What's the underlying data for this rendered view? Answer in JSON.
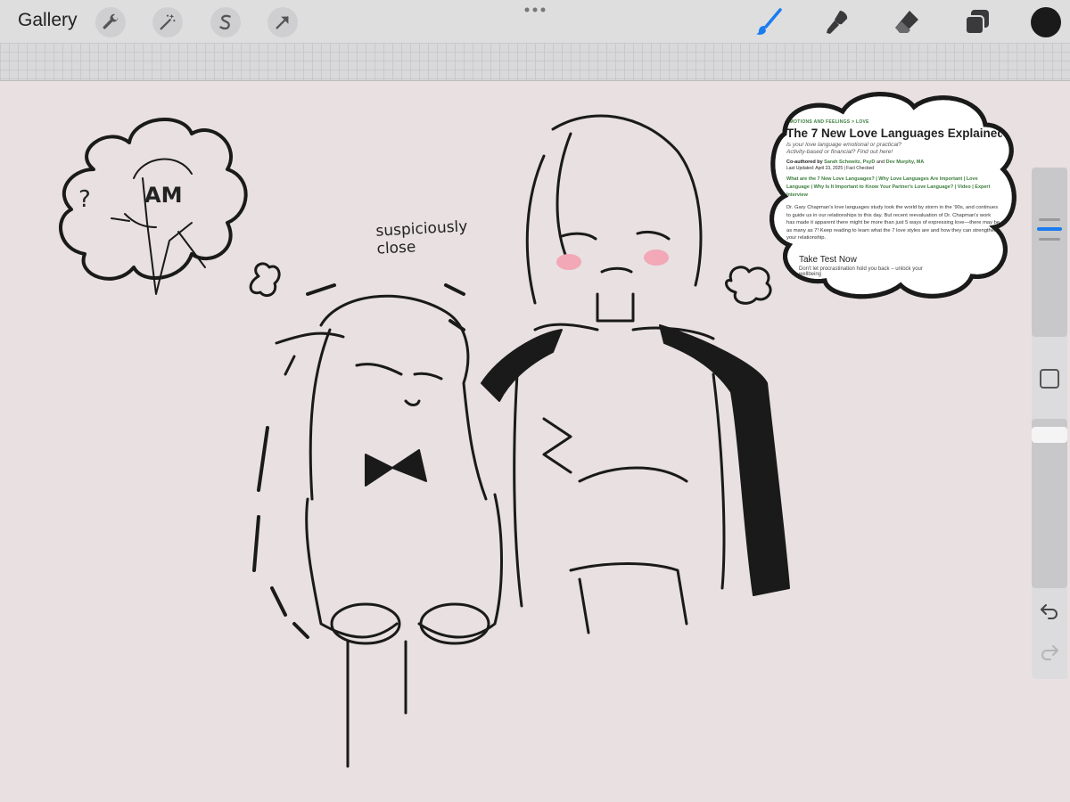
{
  "toolbar": {
    "gallery_label": "Gallery",
    "left_tools": [
      "wrench-icon",
      "magic-wand-icon",
      "selection-icon",
      "transform-arrow-icon"
    ],
    "right_tools": [
      "brush-icon",
      "smudge-icon",
      "eraser-icon",
      "layers-icon",
      "color-swatch"
    ],
    "active_tool": "brush",
    "accent_color": "#1a7cf0",
    "current_color": "#1a1a1a"
  },
  "canvas": {
    "background_color": "#e8e0e1",
    "annotation": "suspiciously\nclose",
    "thought_left": "AM",
    "question_mark": "?"
  },
  "article": {
    "breadcrumb": "EMOTIONS AND FEELINGS  >  LOVE",
    "title": "The 7 New Love Languages Explained",
    "subtitle": "Is your love language emotional or practical? Activity-based or financial? Find out here!",
    "authors_prefix": "Co-authored by",
    "author_1": "Sarah Schewitz, PsyD",
    "authors_and": "and",
    "author_2": "Dev Murphy, MA",
    "last_updated": "Last Updated: April 23, 2025   |  Fact Checked",
    "toc": "What are the 7 New Love Languages?  |  Why Love Languages Are Important  |  Love Language  |  Why Is It Important to Know Your Partner's Love Language?  |  Video  |  Expert Interview",
    "body": "Dr. Gary Chapman's love languages study took the world by storm in the '90s, and continues to guide us in our relationships to this day. But recent reevaluation of Dr. Chapman's work has made it apparent there might be more than just 5 ways of expressing love—there may be as many as 7! Keep reading to learn what the 7 love styles are and how they can strengthen your relationship.",
    "test_heading": "Take Test Now",
    "test_body": "Don't let procrastination hold you back – unlock your wellbeing"
  },
  "sidebar": {
    "brush_size_fraction": 0.66,
    "opacity_fraction": 0.95,
    "modify_button": "square-icon",
    "undo_icon": "undo-icon",
    "redo_icon": "redo-icon"
  }
}
